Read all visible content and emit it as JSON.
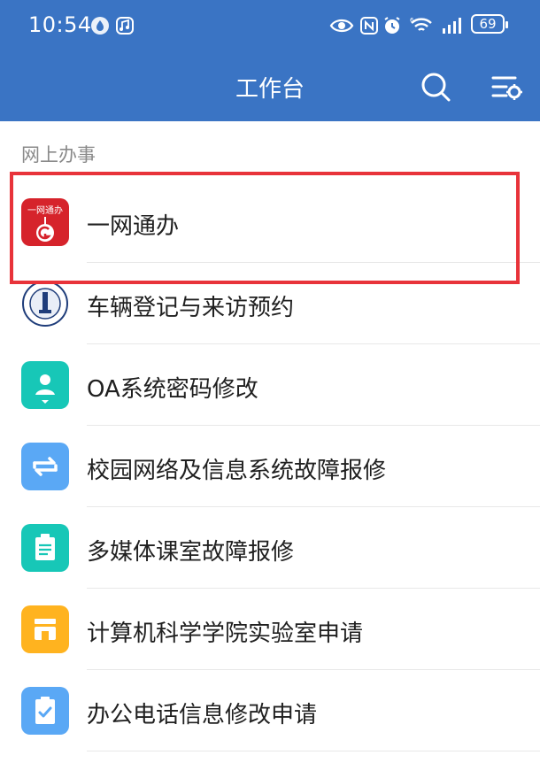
{
  "status_bar": {
    "time": "10:54",
    "battery": "69",
    "icons": [
      "app-drop-icon",
      "app-square-icon",
      "eye-icon",
      "nfc-icon",
      "alarm-icon",
      "wifi-icon",
      "signal-icon",
      "battery-icon"
    ]
  },
  "header": {
    "title": "工作台",
    "search_icon": "search-icon",
    "settings_icon": "list-settings-icon",
    "background": "#3a74c4"
  },
  "section": {
    "title": "网上办事"
  },
  "items": [
    {
      "label": "一网通办",
      "icon": "yiwangtongban-logo",
      "color": "#d6232b",
      "highlighted": true
    },
    {
      "label": "车辆登记与来访预约",
      "icon": "university-seal-icon",
      "color": "#1f3d7a"
    },
    {
      "label": "OA系统密码修改",
      "icon": "user-badge-icon",
      "color": "#17c7b7"
    },
    {
      "label": "校园网络及信息系统故障报修",
      "icon": "sync-arrows-icon",
      "color": "#5aa8f5"
    },
    {
      "label": "多媒体课室故障报修",
      "icon": "clipboard-icon",
      "color": "#17c7b7"
    },
    {
      "label": "计算机科学学院实验室申请",
      "icon": "store-icon",
      "color": "#ffb31f"
    },
    {
      "label": "办公电话信息修改申请",
      "icon": "checklist-icon",
      "color": "#5aa8f5"
    }
  ],
  "highlight_color": "#e8333a",
  "logo_text": "一网通办"
}
